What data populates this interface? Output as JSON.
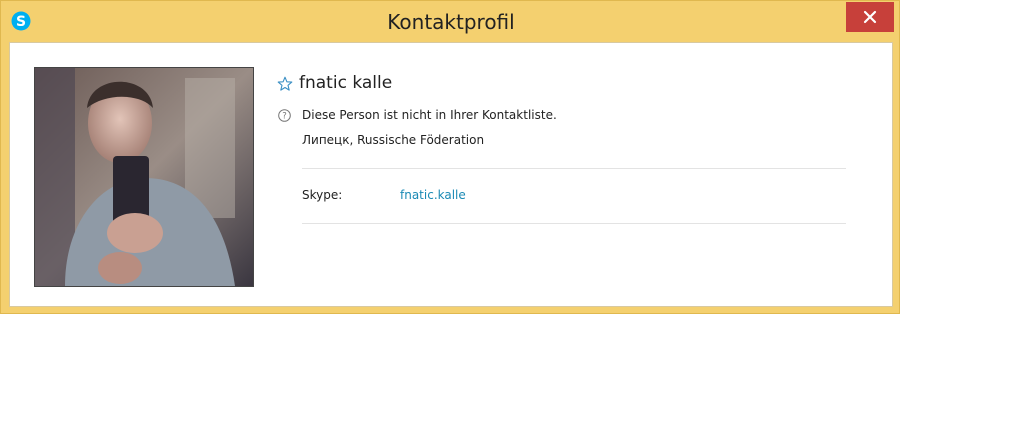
{
  "window": {
    "title": "Kontaktprofil",
    "close_glyph": "✕",
    "app_icon": "skype-icon"
  },
  "profile": {
    "display_name": "fnatic kalle",
    "favorite_icon": "star-outline-icon",
    "status_icon": "help-circle-icon",
    "status_text": "Diese Person ist nicht in Ihrer Kontaktliste.",
    "location": "Липецк, Russische Föderation",
    "fields": [
      {
        "label": "Skype:",
        "value": "fnatic.kalle"
      }
    ]
  },
  "colors": {
    "frame": "#f4d06f",
    "close": "#c7403a",
    "link": "#1a8ab5",
    "skype_blue": "#00aff0"
  }
}
